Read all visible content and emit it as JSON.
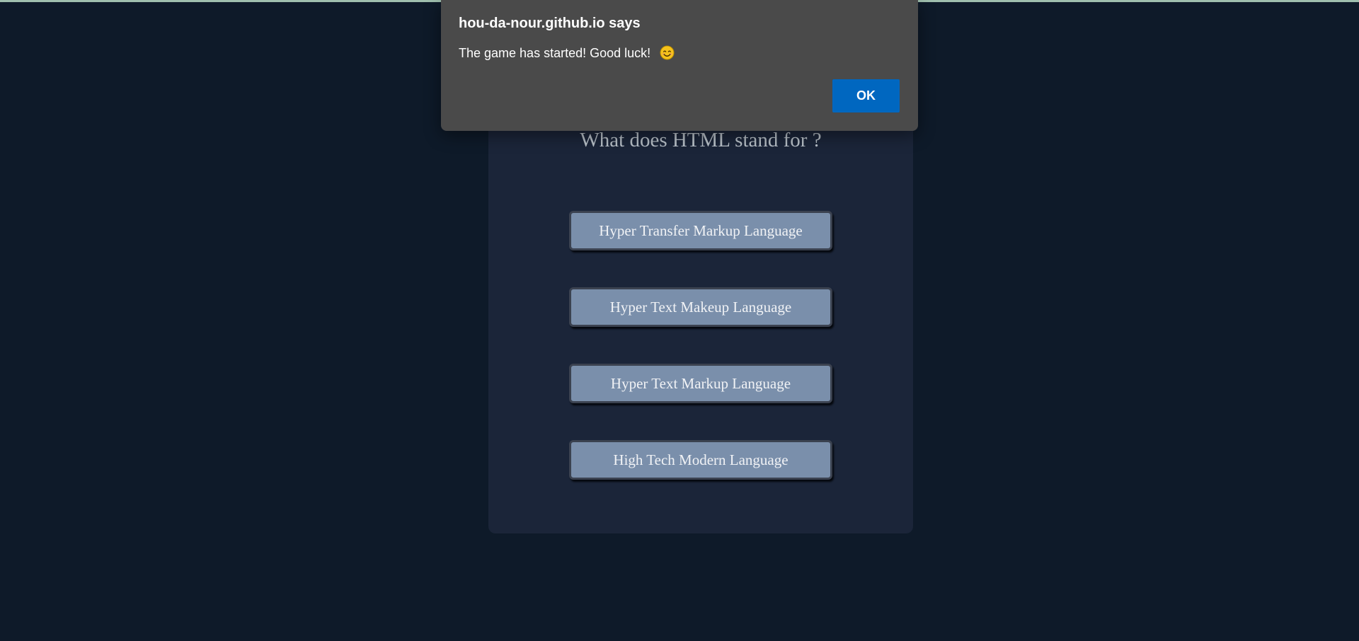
{
  "dialog": {
    "title": "hou-da-nour.github.io says",
    "message": "The game has started! Good luck!",
    "message_icon": "smiling-face-icon",
    "ok_label": "OK",
    "ok_color": "#0067c0"
  },
  "quiz": {
    "question": "What does HTML stand for ?",
    "answers": [
      "Hyper Transfer Markup Language",
      "Hyper Text Makeup Language",
      "Hyper Text Markup Language",
      "High Tech Modern Language"
    ]
  },
  "colors": {
    "background": "#0e1a29",
    "card": "#1b2539",
    "answer_button": "#7a8fab",
    "dialog": "#4a4a4a"
  }
}
